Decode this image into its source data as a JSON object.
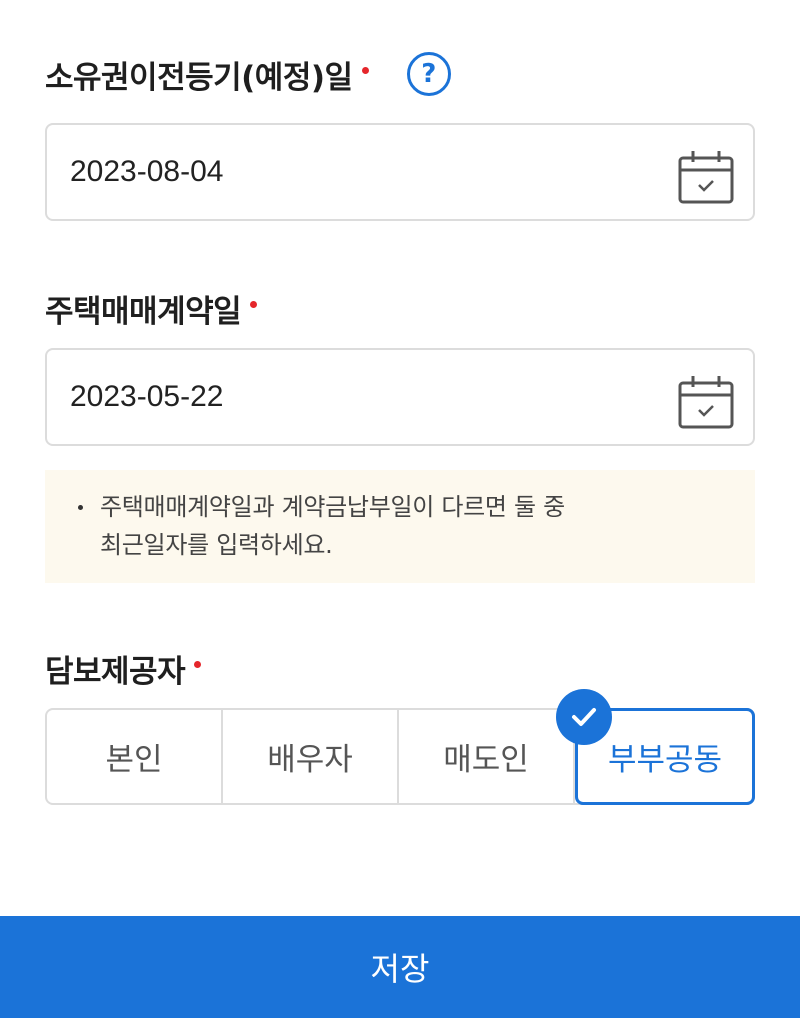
{
  "transfer_date": {
    "label": "소유권이전등기(예정)일",
    "help_icon": "question-icon",
    "value": "2023-08-04"
  },
  "contract_date": {
    "label": "주택매매계약일",
    "value": "2023-05-22"
  },
  "notice": {
    "text": "주택매매계약일과 계약금납부일이 다르면 둘 중\n최근일자를 입력하세요."
  },
  "collateral_provider": {
    "label": "담보제공자",
    "options": [
      "본인",
      "배우자",
      "매도인",
      "부부공동"
    ],
    "selected": "부부공동"
  },
  "save_label": "저장",
  "colors": {
    "accent": "#1b73d8",
    "required_dot": "#e5262b",
    "notice_bg": "#fdf9ee"
  }
}
